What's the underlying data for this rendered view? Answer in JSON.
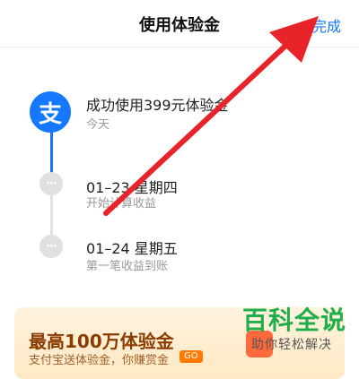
{
  "header": {
    "title": "使用体验金",
    "done_label": "完成"
  },
  "icons": {
    "alipay": "支",
    "dot": "···"
  },
  "timeline": [
    {
      "title": "成功使用399元体验金",
      "subtitle": "今天"
    },
    {
      "title": "01–23 星期四",
      "subtitle": "开始计算收益"
    },
    {
      "title": "01–24 星期五",
      "subtitle": "第一笔收益到账"
    }
  ],
  "promo": {
    "title": "最高100万体验金",
    "subtitle": "支付宝送体验金，你赚赏金",
    "go": "GO"
  },
  "watermark": {
    "top": "百科全说",
    "bottom": "助你轻松解决"
  },
  "colors": {
    "accent": "#1677ff",
    "arrow": "#e8232a",
    "watermark": "#1fae4a"
  }
}
